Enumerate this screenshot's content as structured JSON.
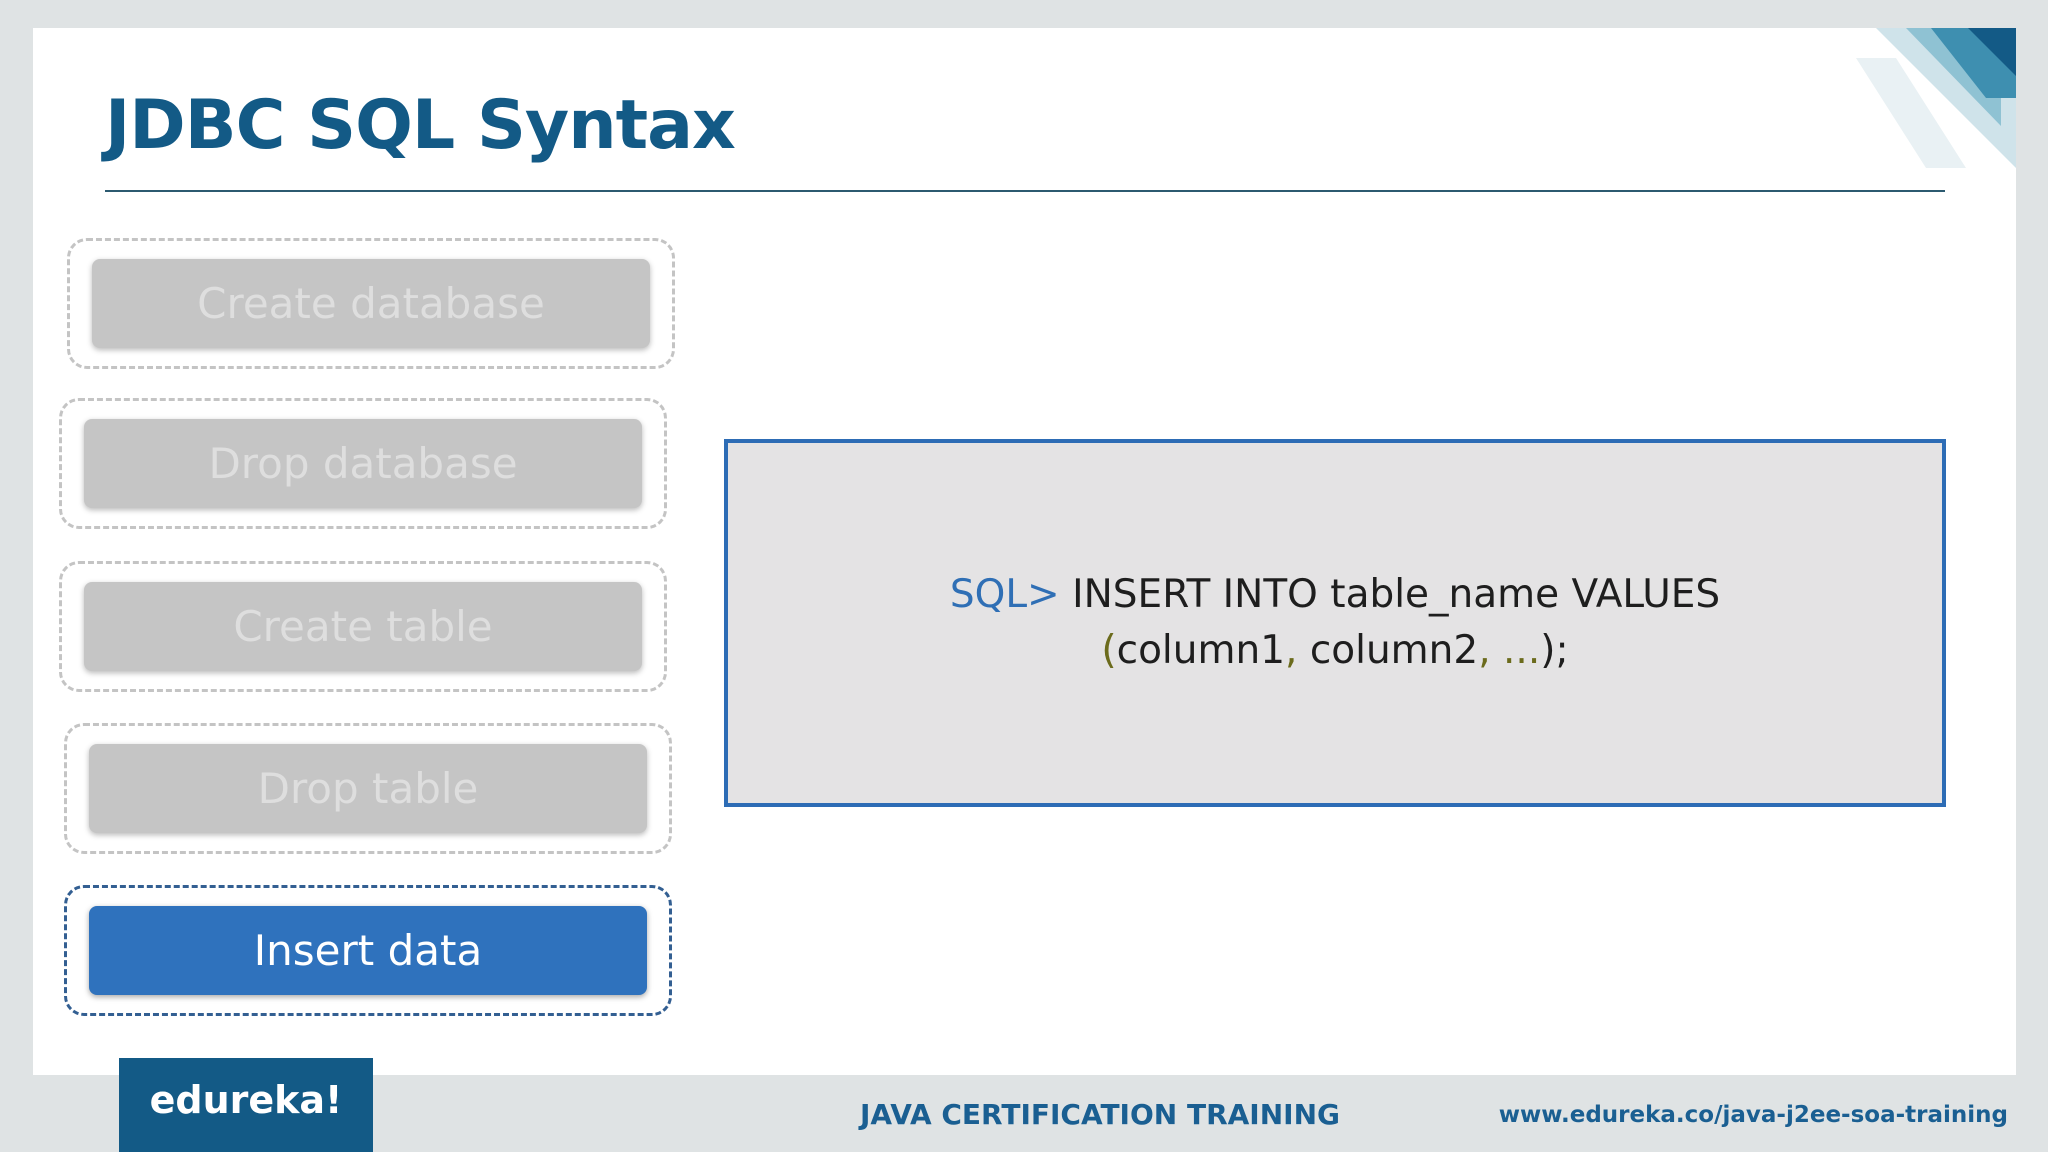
{
  "slide": {
    "title": "JDBC SQL Syntax"
  },
  "steps": [
    {
      "label": "Create database",
      "active": false
    },
    {
      "label": "Drop database",
      "active": false
    },
    {
      "label": "Create table",
      "active": false
    },
    {
      "label": "Drop table",
      "active": false
    },
    {
      "label": "Insert data",
      "active": true
    }
  ],
  "code": {
    "prompt": "SQL>",
    "statement": "INSERT INTO table_name VALUES",
    "open_paren": "(",
    "col1": "column1",
    "comma1": ",",
    "col2": "column2",
    "comma2": ",",
    "ellipsis": "...",
    "close": ");"
  },
  "footer": {
    "logo": "edureka!",
    "course": "JAVA CERTIFICATION TRAINING",
    "url": "www.edureka.co/java-j2ee-soa-training"
  },
  "colors": {
    "brand_dark_blue": "#135a86",
    "active_button": "#2f72bd",
    "inactive_button": "#c5c5c5",
    "code_border": "#2d6cb5",
    "code_background": "#e4e3e4",
    "keyword_blue": "#2f6fb5",
    "punctuation_olive": "#6b6b1c"
  }
}
